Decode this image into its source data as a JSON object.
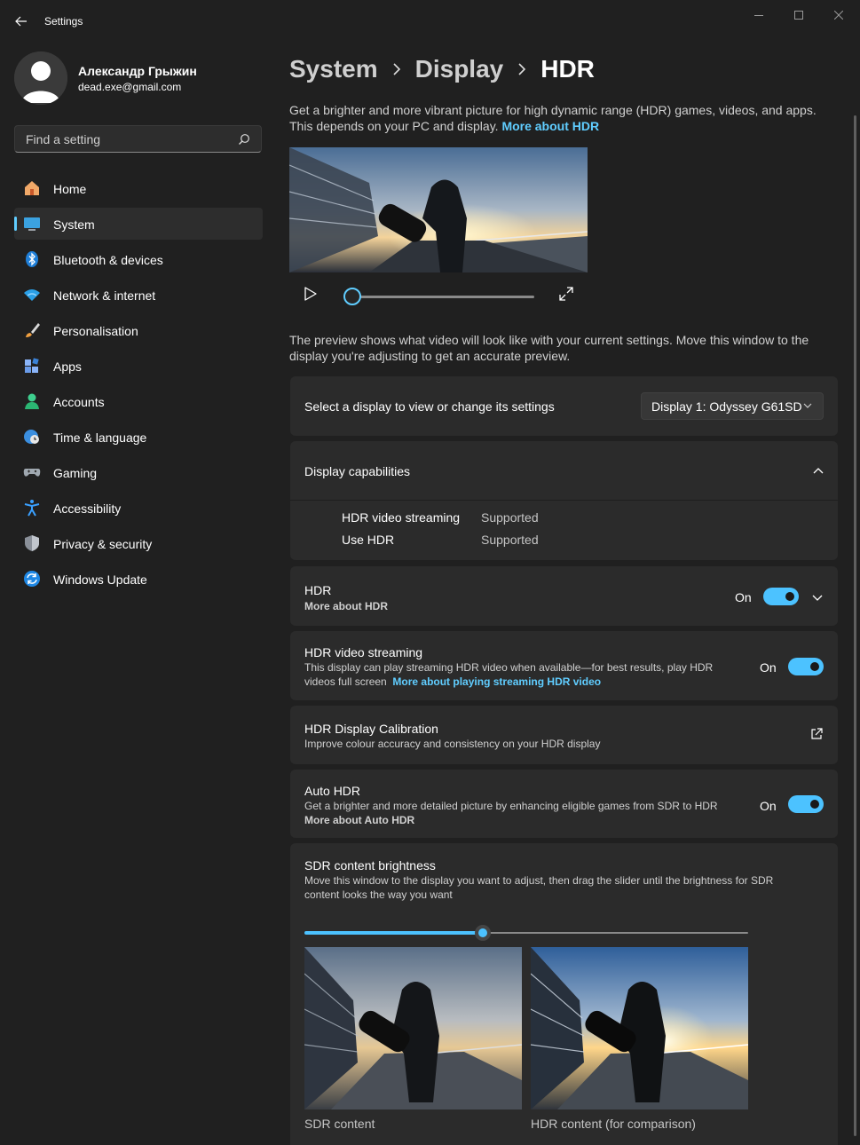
{
  "window": {
    "title": "Settings",
    "controls": [
      "minimize-icon",
      "maximize-icon",
      "close-icon"
    ]
  },
  "profile": {
    "name": "Александр Грыжин",
    "email": "dead.exe@gmail.com"
  },
  "search": {
    "placeholder": "Find a setting"
  },
  "sidebar": {
    "items": [
      {
        "label": "Home",
        "icon": "home-icon"
      },
      {
        "label": "System",
        "icon": "system-icon",
        "active": true
      },
      {
        "label": "Bluetooth & devices",
        "icon": "bluetooth-icon"
      },
      {
        "label": "Network & internet",
        "icon": "wifi-icon"
      },
      {
        "label": "Personalisation",
        "icon": "brush-icon"
      },
      {
        "label": "Apps",
        "icon": "apps-icon"
      },
      {
        "label": "Accounts",
        "icon": "accounts-icon"
      },
      {
        "label": "Time & language",
        "icon": "time-language-icon"
      },
      {
        "label": "Gaming",
        "icon": "gaming-icon"
      },
      {
        "label": "Accessibility",
        "icon": "accessibility-icon"
      },
      {
        "label": "Privacy & security",
        "icon": "shield-icon"
      },
      {
        "label": "Windows Update",
        "icon": "update-icon"
      }
    ]
  },
  "breadcrumb": [
    "System",
    "Display",
    "HDR"
  ],
  "intro": {
    "text": "Get a brighter and more vibrant picture for high dynamic range (HDR) games, videos, and apps. This depends on your PC and display. ",
    "link": "More about HDR"
  },
  "preview": {
    "note": "The preview shows what video will look like with your current settings. Move this window to the display you're adjusting to get an accurate preview.",
    "playback_position": 0
  },
  "display_select": {
    "label": "Select a display to view or change its settings",
    "value": "Display 1: Odyssey G61SD"
  },
  "capabilities": {
    "title": "Display capabilities",
    "rows": [
      {
        "label": "HDR video streaming",
        "value": "Supported"
      },
      {
        "label": "Use HDR",
        "value": "Supported"
      }
    ]
  },
  "hdr": {
    "title": "HDR",
    "link": "More about HDR",
    "state": "On"
  },
  "hdr_streaming": {
    "title": "HDR video streaming",
    "desc1": "This display can play streaming HDR video when available—for best results, play HDR",
    "desc2": "videos full screen",
    "link": "More about playing streaming HDR video",
    "state": "On"
  },
  "calibration": {
    "title": "HDR Display Calibration",
    "desc": "Improve colour accuracy and consistency on your HDR display"
  },
  "auto_hdr": {
    "title": "Auto HDR",
    "desc": "Get a brighter and more detailed picture by enhancing eligible games from SDR to HDR",
    "link": "More about Auto HDR",
    "state": "On"
  },
  "sdr_brightness": {
    "title": "SDR content brightness",
    "desc1": "Move this window to the display you want to adjust, then drag the slider until the brightness for SDR",
    "desc2": "content looks the way you want",
    "slider_fraction": 0.4,
    "sdr_label": "SDR content",
    "hdr_label": "HDR content (for comparison)"
  },
  "colors": {
    "accent": "#60cdff",
    "toggle_on": "#4cc2ff",
    "background": "#202020",
    "card": "#2b2b2b"
  }
}
